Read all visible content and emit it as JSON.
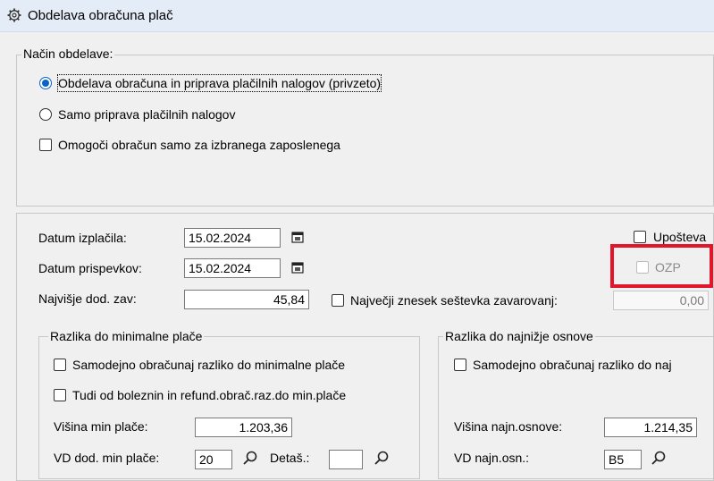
{
  "window": {
    "title": "Obdelava obračuna plač",
    "icon": "gear-icon"
  },
  "nacin": {
    "legend": "Način obdelave:",
    "radio_full_label": "Obdelava obračuna in priprava plačilnih nalogov (privzeto)",
    "radio_full_checked": true,
    "radio_nalogi_label": "Samo priprava plačilnih nalogov",
    "radio_nalogi_checked": false,
    "check_zaposleni_label": "Omogoči obračun samo za izbranega zaposlenega",
    "check_zaposleni_checked": false
  },
  "datum": {
    "izplacila_label": "Datum izplačila:",
    "izplacila_value": "15.02.2024",
    "prispevkov_label": "Datum prispevkov:",
    "prispevkov_value": "15.02.2024",
    "calendar_icon": "calendar-icon"
  },
  "upostevaj_label": "Upošteva",
  "ozp_label": "OZP",
  "najvisje": {
    "label": "Najvišje dod. zav:",
    "value": "45,84",
    "znesek_label": "Največji znesek seštevka zavarovanj:",
    "znesek_value": "0,00"
  },
  "minimalna": {
    "legend": "Razlika do minimalne plače",
    "check_samodejno_label": "Samodejno obračunaj razliko do minimalne plače",
    "check_bolezni_label": "Tudi od boleznin in refund.obrač.raz.do min.plače",
    "visina_label": "Višina min plače:",
    "visina_value": "1.203,36",
    "vd_label": "VD dod. min plače:",
    "vd_value": "20",
    "detas_label": "Detaš.:",
    "detas_value": ""
  },
  "osnova": {
    "legend": "Razlika do najnižje osnove",
    "check_samodejno_label": "Samodejno obračunaj razliko do naj",
    "visina_label": "Višina najn.osnove:",
    "visina_value": "1.214,35",
    "vd_label": "VD najn.osn.:",
    "vd_value": "B5"
  },
  "colors": {
    "highlight": "#e3152b",
    "radio_accent": "#0a64c8"
  }
}
